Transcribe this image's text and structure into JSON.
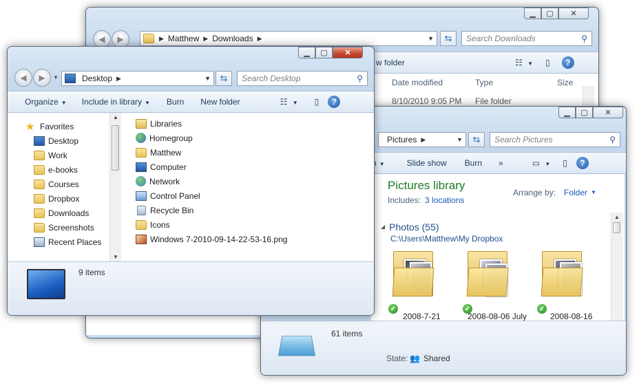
{
  "downloads_window": {
    "breadcrumb": [
      "Matthew",
      "Downloads"
    ],
    "search_placeholder": "Search Downloads",
    "toolbar_partial": "w folder",
    "columns": [
      "Date modified",
      "Type",
      "Size"
    ],
    "first_row": {
      "date": "8/10/2010 9:05 PM",
      "type": "File folder"
    }
  },
  "desktop_window": {
    "breadcrumb": [
      "Desktop"
    ],
    "search_placeholder": "Search Desktop",
    "toolbar": [
      "Organize",
      "Include in library",
      "Burn",
      "New folder"
    ],
    "favorites_label": "Favorites",
    "nav_items": [
      "Desktop",
      "Work",
      "e-books",
      "Courses",
      "Dropbox",
      "Downloads",
      "Screenshots",
      "Recent Places"
    ],
    "files": [
      {
        "name": "Libraries",
        "icon": "library-icon"
      },
      {
        "name": "Homegroup",
        "icon": "homegroup-icon"
      },
      {
        "name": "Matthew",
        "icon": "user-folder-icon"
      },
      {
        "name": "Computer",
        "icon": "computer-icon"
      },
      {
        "name": "Network",
        "icon": "network-icon"
      },
      {
        "name": "Control Panel",
        "icon": "control-panel-icon"
      },
      {
        "name": "Recycle Bin",
        "icon": "recycle-bin-icon"
      },
      {
        "name": "Icons",
        "icon": "folder-icon"
      },
      {
        "name": "Windows 7-2010-09-14-22-53-16.png",
        "icon": "image-file-icon"
      }
    ],
    "status": "9 items"
  },
  "pictures_window": {
    "breadcrumb": [
      "Pictures"
    ],
    "search_placeholder": "Search Pictures",
    "toolbar_partial": "h",
    "toolbar": [
      "Slide show",
      "Burn",
      "»"
    ],
    "library_title": "Pictures library",
    "includes_label": "Includes:",
    "includes_link": "3 locations",
    "arrange_label": "Arrange by:",
    "arrange_value": "Folder",
    "group_title": "Photos (55)",
    "group_path": "C:\\Users\\Matthew\\My Dropbox",
    "folders": [
      "2008-7-21",
      "2008-08-06 July",
      "2008-08-16"
    ],
    "status_count": "61 items",
    "state_label": "State:",
    "state_value": "Shared"
  },
  "colors": {
    "close_red": "#c64a32",
    "link_blue": "#1a59b5",
    "library_green": "#1f7a2a",
    "group_blue": "#1e4e8c"
  }
}
